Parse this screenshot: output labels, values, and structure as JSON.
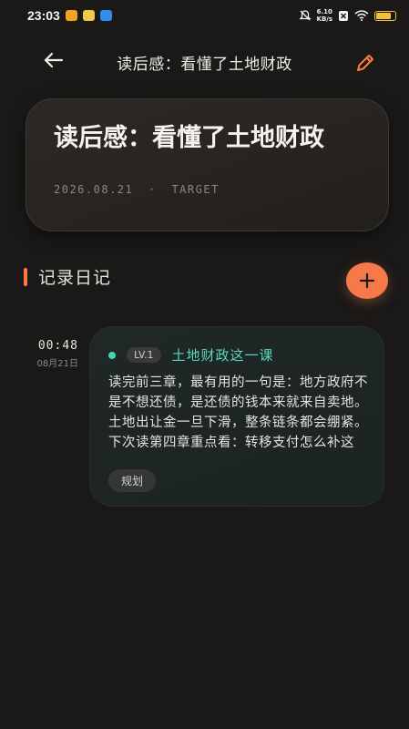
{
  "status_bar": {
    "time": "23:03",
    "net_speed_value": "6.10",
    "net_speed_unit": "KB/s",
    "notification_colors": [
      "#f3a31f",
      "#f0c84a",
      "#2e8ef0"
    ],
    "battery_color": "#f0c23a"
  },
  "header": {
    "title": "读后感：看懂了土地财政",
    "back_icon": "arrow-left-icon",
    "edit_icon": "pencil-icon",
    "edit_color": "#ff7b43"
  },
  "target_card": {
    "title": "读后感：看懂了土地财政",
    "date": "2026.08.21",
    "separator": "·",
    "type": "TARGET"
  },
  "section": {
    "title": "记录日记",
    "accent": "#ff7b43",
    "add_icon": "plus-icon",
    "add_color": "#f6794a"
  },
  "entries": [
    {
      "time": "00:48",
      "date": "08月21日",
      "level": "LV.1",
      "title": "土地财政这一课",
      "body": "读完前三章，最有用的一句是：地方政府不是不想还债，是还债的钱本来就来自卖地。土地出让金一旦下滑，整条链条都会绷紧。下次读第四章重点看：转移支付怎么补这",
      "tag": "规划",
      "accent": "#43d6b7"
    }
  ]
}
